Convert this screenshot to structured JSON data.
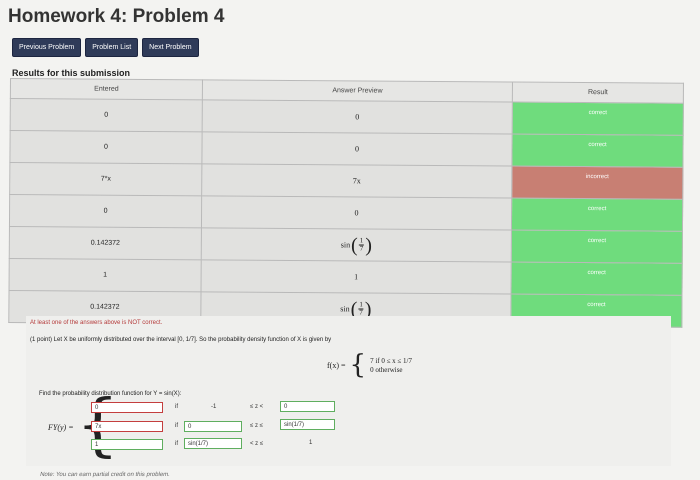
{
  "header": {
    "title": "Homework 4: Problem 4",
    "buttons": [
      "Previous Problem",
      "Problem List",
      "Next Problem"
    ]
  },
  "results": {
    "section_label": "Results for this submission",
    "columns": [
      "Entered",
      "Answer Preview",
      "Result"
    ],
    "rows": [
      {
        "entered": "0",
        "preview": "0",
        "result": "correct",
        "status": "correct"
      },
      {
        "entered": "0",
        "preview": "0",
        "result": "correct",
        "status": "correct"
      },
      {
        "entered": "7*x",
        "preview": "7x",
        "result": "incorrect",
        "status": "incorrect"
      },
      {
        "entered": "0",
        "preview": "0",
        "result": "correct",
        "status": "correct"
      },
      {
        "entered": "0.142372",
        "preview": "sin(1/7)",
        "result": "correct",
        "status": "correct"
      },
      {
        "entered": "1",
        "preview": "1",
        "result": "correct",
        "status": "correct"
      },
      {
        "entered": "0.142372",
        "preview": "sin(1/7)",
        "result": "correct",
        "status": "correct"
      }
    ],
    "preview_sin": {
      "fn": "sin",
      "num": "1",
      "den": "7"
    }
  },
  "problem": {
    "warning": "At least one of the answers above is NOT correct.",
    "statement": "(1 point) Let X be uniformly distributed over the interval [0, 1/7]. So the probability density function of X is given by",
    "density": {
      "lhs": "f(x) =",
      "case1": "7   if 0 ≤ x ≤ 1/7",
      "case2": "0   otherwise"
    },
    "find_label": "Find the probability distribution function for Y = sin(X):",
    "fy_label": "FY(y) =",
    "fields": {
      "r1_value": "0",
      "r2_value": "7x",
      "r3_value": "1",
      "r1_bound": "0",
      "r2_lower": "0",
      "r2_upper": "sin(1/7)",
      "r3_lower": "sin(1/7)"
    },
    "labels": {
      "if1": "if",
      "if2": "if",
      "if3": "if",
      "minus_one": "-1",
      "le_lt": "≤ z <",
      "le_le": "≤ z ≤",
      "lt_le": "< z ≤",
      "one": "1"
    }
  },
  "footer": {
    "note": "Note: You can earn partial credit on this problem."
  },
  "colors": {
    "correct": "#6fdc7d",
    "incorrect": "#c87f73",
    "button": "#2f3b59"
  }
}
